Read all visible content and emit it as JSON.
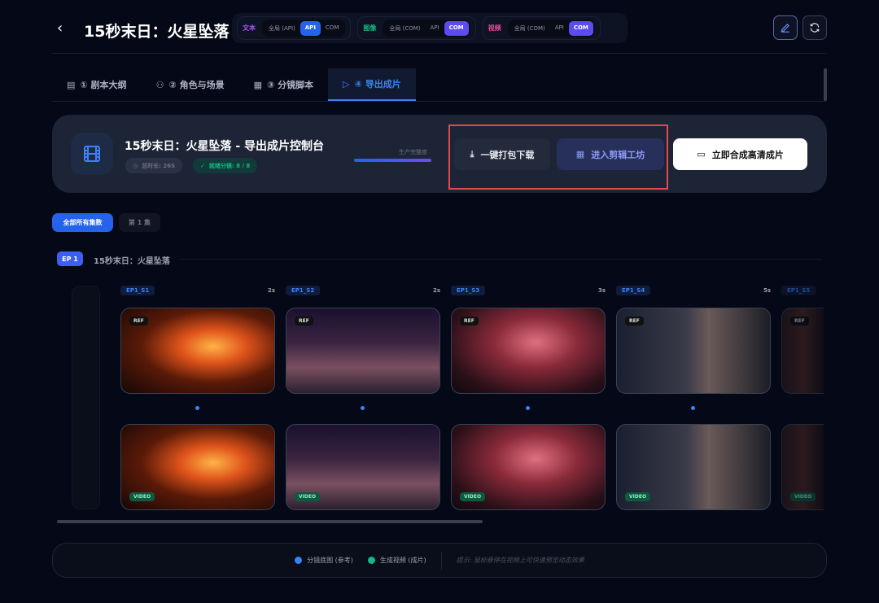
{
  "header": {
    "back_icon": "chevron-left-icon",
    "title": "15秒末日：火星坠落",
    "modes": [
      {
        "label": "文本",
        "color": "#a855f7",
        "options": [
          "全局 (API)",
          "API",
          "COM"
        ],
        "selected": "API",
        "sel_color": "#2563eb"
      },
      {
        "label": "图像",
        "color": "#10b981",
        "options": [
          "全局 (COM)",
          "API",
          "COM"
        ],
        "selected": "COM",
        "sel_color": "#5b4cf0"
      },
      {
        "label": "视频",
        "color": "#ec4899",
        "options": [
          "全局 (COM)",
          "API",
          "COM"
        ],
        "selected": "COM",
        "sel_color": "#5b4cf0"
      }
    ]
  },
  "tabs": [
    {
      "label": "① 剧本大纲",
      "icon": "document-icon"
    },
    {
      "label": "② 角色与场景",
      "icon": "users-icon"
    },
    {
      "label": "③ 分镜脚本",
      "icon": "film-icon"
    },
    {
      "label": "④ 导出成片",
      "icon": "play-circle-icon",
      "active": true
    }
  ],
  "console": {
    "title": "15秒末日：火星坠落 - 导出成片控制台",
    "duration": "总时长: 26S",
    "ready": "就绪分镜: 8 / 8",
    "progress_label": "生产完整度",
    "progress": 100,
    "download": "一键打包下载",
    "editor": "进入剪辑工坊",
    "compose": "立即合成高清成片"
  },
  "filters": [
    "全部所有集数",
    "第 1 集"
  ],
  "episode": {
    "badge": "EP 1",
    "title": "15秒末日：火星坠落"
  },
  "shots": [
    {
      "id": "EP1_S1",
      "dur": "2s",
      "scene": "meteor"
    },
    {
      "id": "EP1_S2",
      "dur": "2s",
      "scene": "balcony"
    },
    {
      "id": "EP1_S3",
      "dur": "3s",
      "scene": "phone"
    },
    {
      "id": "EP1_S4",
      "dur": "5s",
      "scene": "window"
    },
    {
      "id": "EP1_S5",
      "dur": "",
      "scene": "dark"
    }
  ],
  "tags": {
    "ref": "REF",
    "video": "VIDEO"
  },
  "legend": {
    "ref": "分镜底图 (参考)",
    "video": "生成视频 (成片)",
    "hint": "提示: 鼠标悬停在视频上可快速预览动态效果"
  },
  "colors": {
    "accent": "#3b82f6",
    "video": "#10b981",
    "highlight": "#e5484d"
  }
}
